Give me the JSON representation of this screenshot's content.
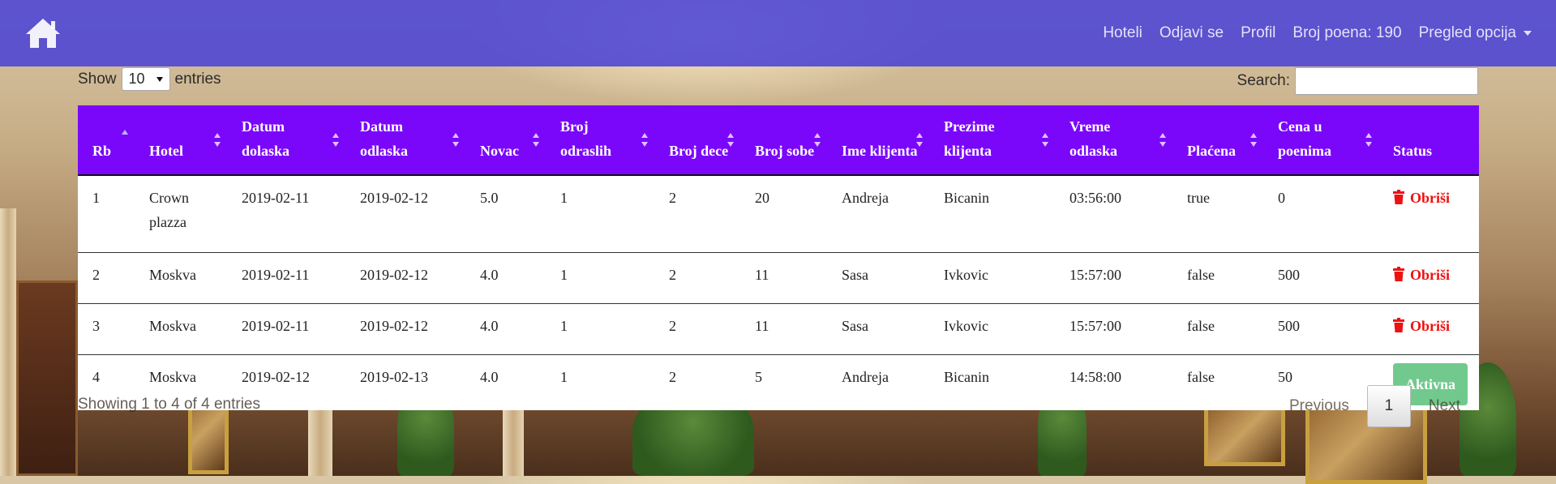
{
  "navbar": {
    "home_icon": "home-icon",
    "links": [
      "Hoteli",
      "Odjavi se",
      "Profil",
      "Broj poena: 190"
    ],
    "dropdown_label": "Pregled opcija"
  },
  "length_control": {
    "show_label": "Show",
    "value": "10",
    "entries_label": "entries"
  },
  "search": {
    "label": "Search:",
    "value": ""
  },
  "table": {
    "headers": [
      "Rb",
      "Hotel",
      "Datum dolaska",
      "Datum odlaska",
      "Novac",
      "Broj odraslih",
      "Broj dece",
      "Broj sobe",
      "Ime klijenta",
      "Prezime klijenta",
      "Vreme odlaska",
      "Plaćena",
      "Cena u poenima",
      "Status"
    ],
    "rows": [
      {
        "rb": "1",
        "hotel": "Crown plazza",
        "datum_dolaska": "2019-02-11",
        "datum_odlaska": "2019-02-12",
        "novac": "5.0",
        "broj_odraslih": "1",
        "broj_dece": "2",
        "broj_sobe": "20",
        "ime": "Andreja",
        "prezime": "Bicanin",
        "vreme_odlaska": "03:56:00",
        "placena": "true",
        "cena": "0",
        "status": "Obriši"
      },
      {
        "rb": "2",
        "hotel": "Moskva",
        "datum_dolaska": "2019-02-11",
        "datum_odlaska": "2019-02-12",
        "novac": "4.0",
        "broj_odraslih": "1",
        "broj_dece": "2",
        "broj_sobe": "11",
        "ime": "Sasa",
        "prezime": "Ivkovic",
        "vreme_odlaska": "15:57:00",
        "placena": "false",
        "cena": "500",
        "status": "Obriši"
      },
      {
        "rb": "3",
        "hotel": "Moskva",
        "datum_dolaska": "2019-02-11",
        "datum_odlaska": "2019-02-12",
        "novac": "4.0",
        "broj_odraslih": "1",
        "broj_dece": "2",
        "broj_sobe": "11",
        "ime": "Sasa",
        "prezime": "Ivkovic",
        "vreme_odlaska": "15:57:00",
        "placena": "false",
        "cena": "500",
        "status": "Obriši"
      },
      {
        "rb": "4",
        "hotel": "Moskva",
        "datum_dolaska": "2019-02-12",
        "datum_odlaska": "2019-02-13",
        "novac": "4.0",
        "broj_odraslih": "1",
        "broj_dece": "2",
        "broj_sobe": "5",
        "ime": "Andreja",
        "prezime": "Bicanin",
        "vreme_odlaska": "14:58:00",
        "placena": "false",
        "cena": "50",
        "status": "Aktivna"
      }
    ]
  },
  "footer": {
    "info": "Showing 1 to 4 of 4 entries",
    "previous": "Previous",
    "page": "1",
    "next": "Next"
  },
  "colors": {
    "navbar": "#4840d6",
    "table_header": "#7b07fb",
    "delete": "#ee1111",
    "active": "#72c98d"
  }
}
